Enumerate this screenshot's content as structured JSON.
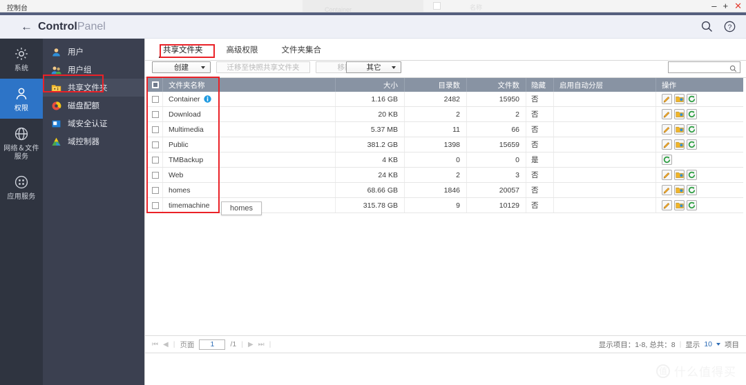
{
  "os_bar": {
    "title": "控制台",
    "ghost_label": "Container",
    "ghost_text2": "名称",
    "minimize": "–",
    "maximize": "+",
    "close": "✕"
  },
  "header": {
    "back_icon": "back-arrow-icon",
    "title_bold": "Control",
    "title_light": "Panel",
    "search_icon": "search-icon",
    "help_icon": "help-icon"
  },
  "rail": {
    "items": [
      {
        "label": "系统",
        "icon": "gear-icon",
        "active": false
      },
      {
        "label": "权限",
        "icon": "user-icon",
        "active": true
      },
      {
        "label": "网络＆文件服务",
        "icon": "globe-icon",
        "active": false
      },
      {
        "label": "应用服务",
        "icon": "grid-icon",
        "active": false
      }
    ],
    "accent": "#2d74c7",
    "background": "#2f3440"
  },
  "submenu": {
    "background": "#3b4050",
    "items": [
      {
        "label": "用户",
        "icon": "user-blue-icon",
        "selected": false
      },
      {
        "label": "用户组",
        "icon": "users-group-icon",
        "selected": false
      },
      {
        "label": "共享文件夹",
        "icon": "shared-folder-icon",
        "selected": true
      },
      {
        "label": "磁盘配额",
        "icon": "quota-pie-icon",
        "selected": false
      },
      {
        "label": "域安全认证",
        "icon": "domain-security-icon",
        "selected": false
      },
      {
        "label": "域控制器",
        "icon": "domain-controller-icon",
        "selected": false
      }
    ]
  },
  "tabs": [
    {
      "label": "共享文件夹",
      "active": true
    },
    {
      "label": "高级权限",
      "active": false
    },
    {
      "label": "文件夹集合",
      "active": false
    }
  ],
  "toolbar": {
    "create_label": "创建",
    "migrate_label": "迁移至快照共享文件夹",
    "remove_label": "移除",
    "other_label": "其它",
    "search_value": "",
    "search_placeholder": "",
    "search_icon": "search-icon"
  },
  "table": {
    "columns": [
      "文件夹名称",
      "大小",
      "目录数",
      "文件数",
      "隐藏",
      "启用自动分层",
      "操作"
    ],
    "rows": [
      {
        "name": "Container",
        "has_info": true,
        "size": "1.16 GB",
        "dirs": "2482",
        "files": "15950",
        "hidden": "否",
        "tiering": "",
        "actions": [
          "edit-icon",
          "permissions-icon",
          "refresh-icon"
        ]
      },
      {
        "name": "Download",
        "has_info": false,
        "size": "20 KB",
        "dirs": "2",
        "files": "2",
        "hidden": "否",
        "tiering": "",
        "actions": [
          "edit-icon",
          "permissions-icon",
          "refresh-icon"
        ]
      },
      {
        "name": "Multimedia",
        "has_info": false,
        "size": "5.37 MB",
        "dirs": "11",
        "files": "66",
        "hidden": "否",
        "tiering": "",
        "actions": [
          "edit-icon",
          "permissions-icon",
          "refresh-icon"
        ]
      },
      {
        "name": "Public",
        "has_info": false,
        "size": "381.2 GB",
        "dirs": "1398",
        "files": "15659",
        "hidden": "否",
        "tiering": "",
        "actions": [
          "edit-icon",
          "permissions-icon",
          "refresh-icon"
        ]
      },
      {
        "name": "TMBackup",
        "has_info": false,
        "size": "4 KB",
        "dirs": "0",
        "files": "0",
        "hidden": "是",
        "tiering": "",
        "actions": [
          "refresh-icon"
        ]
      },
      {
        "name": "Web",
        "has_info": false,
        "size": "24 KB",
        "dirs": "2",
        "files": "3",
        "hidden": "否",
        "tiering": "",
        "actions": [
          "edit-icon",
          "permissions-icon",
          "refresh-icon"
        ]
      },
      {
        "name": "homes",
        "has_info": false,
        "size": "68.66 GB",
        "dirs": "1846",
        "files": "20057",
        "hidden": "否",
        "tiering": "",
        "actions": [
          "edit-icon",
          "permissions-icon",
          "refresh-icon"
        ]
      },
      {
        "name": "timemachine",
        "has_info": false,
        "size": "315.78 GB",
        "dirs": "9",
        "files": "10129",
        "hidden": "否",
        "tiering": "",
        "actions": [
          "edit-icon",
          "permissions-icon",
          "refresh-icon"
        ]
      }
    ]
  },
  "tooltip": {
    "text": "homes"
  },
  "pager": {
    "first_icon": "⏮",
    "prev_icon": "◀",
    "page_label": "页面",
    "page_value": "1",
    "page_total": "/1",
    "next_icon": "▶",
    "last_icon": "⏭",
    "summary": "显示项目：1-8, 总共：8",
    "show_label": "显示",
    "page_size": "10",
    "items_label": "项目"
  },
  "watermark": {
    "badge": "值",
    "text": "什么值得买"
  }
}
